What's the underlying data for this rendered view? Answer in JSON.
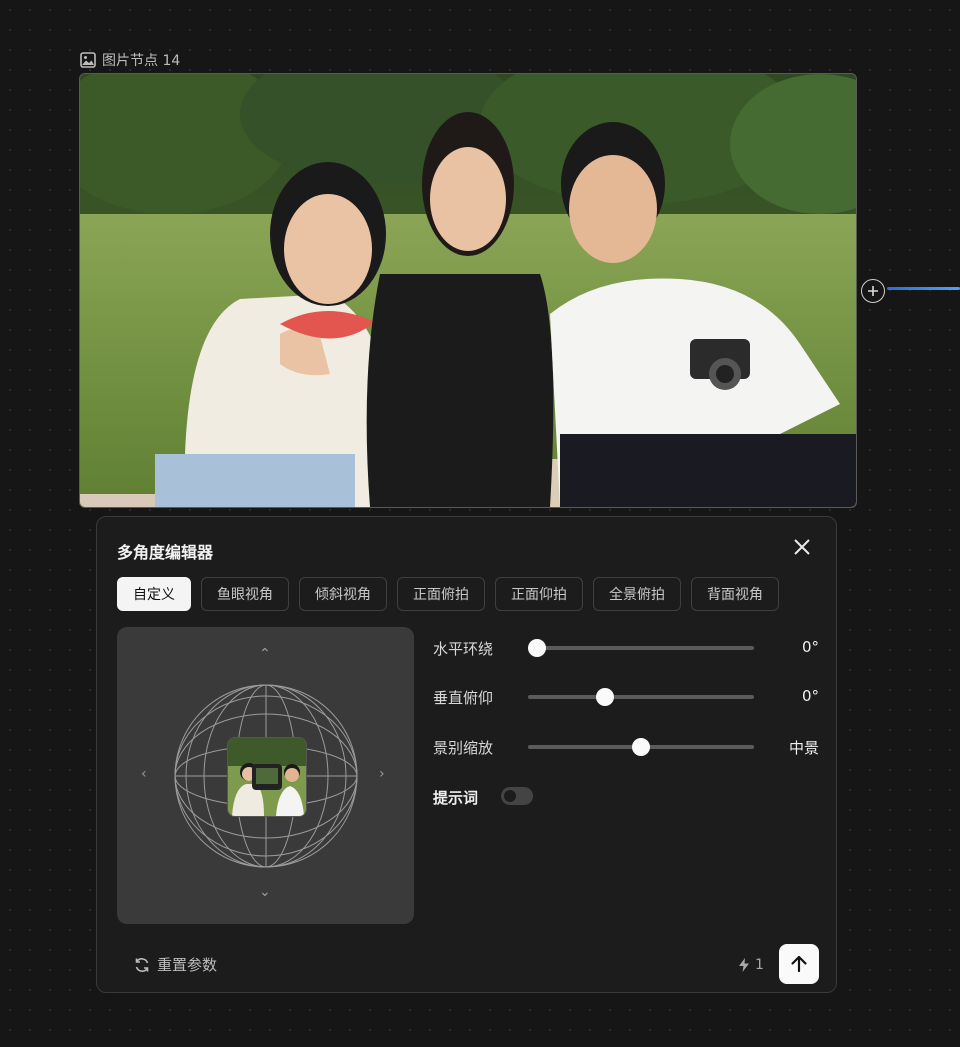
{
  "node": {
    "title": "图片节点 14",
    "icon": "image-icon"
  },
  "editor": {
    "title": "多角度编辑器",
    "tabs": [
      {
        "label": "自定义",
        "active": true
      },
      {
        "label": "鱼眼视角",
        "active": false
      },
      {
        "label": "倾斜视角",
        "active": false
      },
      {
        "label": "正面俯拍",
        "active": false
      },
      {
        "label": "正面仰拍",
        "active": false
      },
      {
        "label": "全景俯拍",
        "active": false
      },
      {
        "label": "背面视角",
        "active": false
      }
    ],
    "sliders": {
      "horizontal": {
        "label": "水平环绕",
        "value": "0°",
        "level": 0.04
      },
      "vertical": {
        "label": "垂直俯仰",
        "value": "0°",
        "level": 0.34
      },
      "zoom": {
        "label": "景别缩放",
        "value": "中景",
        "level": 0.5
      }
    },
    "prompt": {
      "label": "提示词",
      "enabled": false
    },
    "reset_label": "重置参数",
    "credit_count": "1"
  },
  "colors": {
    "accent": "#4da3ff",
    "panel": "#1c1c1c",
    "viewer": "#3a3a3a"
  }
}
